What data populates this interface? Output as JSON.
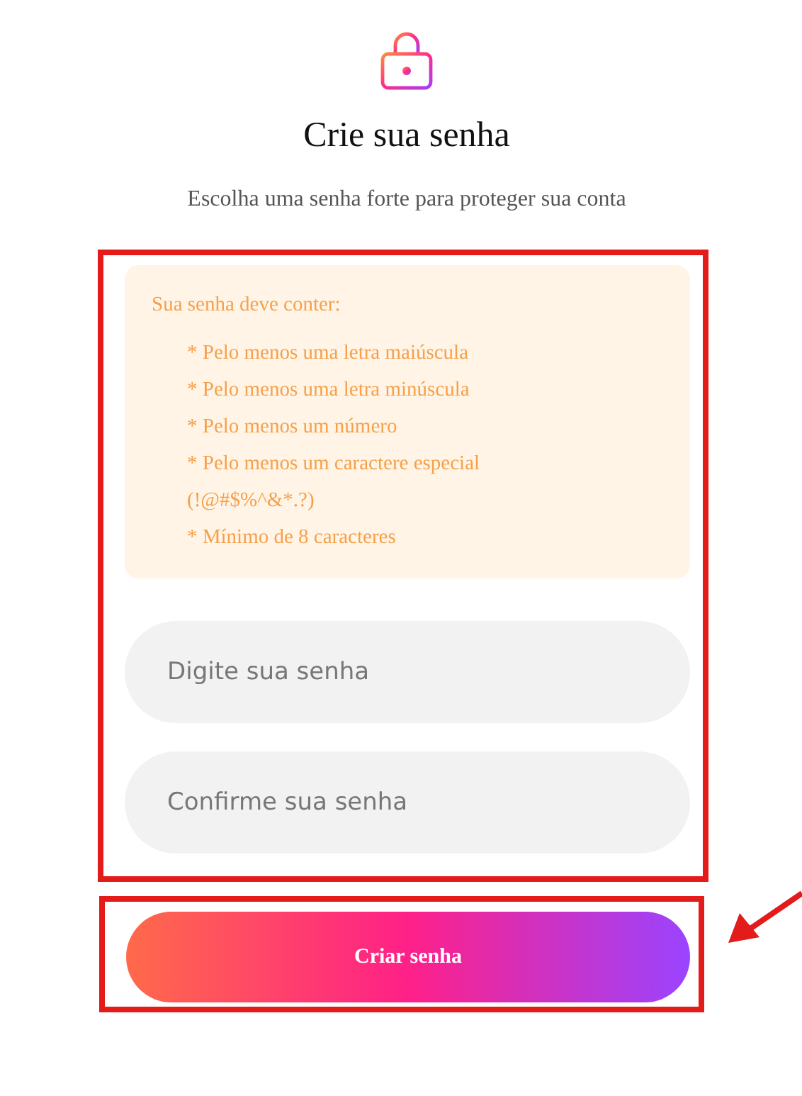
{
  "title": "Crie sua senha",
  "subtitle": "Escolha uma senha forte para proteger sua conta",
  "requirements": {
    "heading": "Sua senha deve conter:",
    "lines": [
      "* Pelo menos uma letra maiúscula",
      "* Pelo menos uma letra minúscula",
      "* Pelo menos um número",
      "* Pelo menos um caractere especial",
      "(!@#$%^&*.?)",
      "* Mínimo de 8 caracteres"
    ]
  },
  "fields": [
    {
      "placeholder": "Digite sua senha"
    },
    {
      "placeholder": "Confirme sua senha"
    }
  ],
  "submit": {
    "label": "Criar senha"
  }
}
